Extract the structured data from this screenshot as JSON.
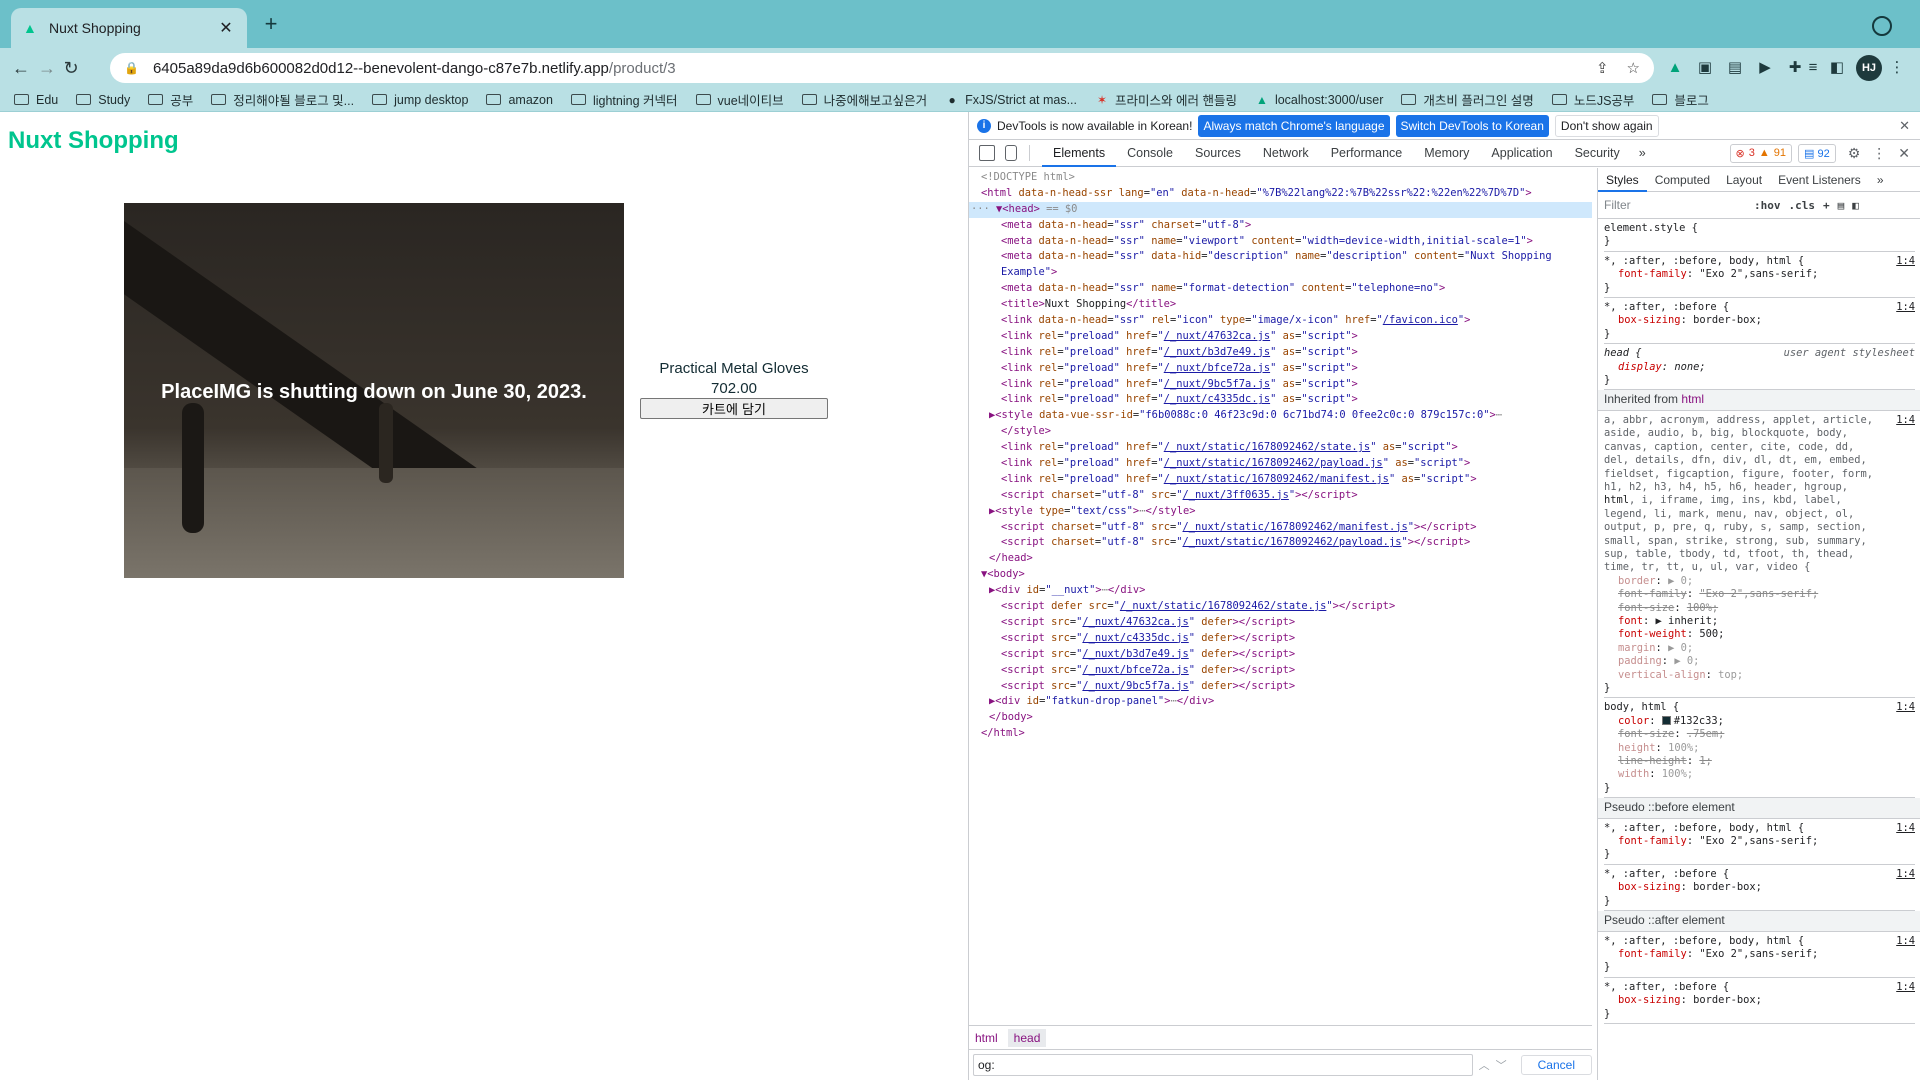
{
  "browser": {
    "tab_title": "Nuxt Shopping",
    "url_host": "6405a89da9d6b600082d0d12--benevolent-dango-c87e7b.netlify.app",
    "url_path": "/product/3",
    "avatar_initials": "HJ",
    "bookmarks": [
      "Edu",
      "Study",
      "공부",
      "정리해야될 블로그 및...",
      "jump desktop",
      "amazon",
      "lightning 커넥터",
      "vue네이티브",
      "나중에해보고싶은거",
      "FxJS/Strict at mas...",
      "프라미스와 에러 핸들링",
      "localhost:3000/user",
      "개츠비 플러그인 설명",
      "노드JS공부",
      "블로그"
    ]
  },
  "page": {
    "brand": "Nuxt Shopping",
    "image_caption": "PlaceIMG is shutting down on June 30, 2023.",
    "product_name": "Practical Metal Gloves",
    "product_price": "702.00",
    "cart_button": "카트에 담기"
  },
  "devtools": {
    "notice": "DevTools is now available in Korean!",
    "btn_match": "Always match Chrome's language",
    "btn_switch": "Switch DevTools to Korean",
    "btn_dont_show": "Don't show again",
    "tabs": [
      "Elements",
      "Console",
      "Sources",
      "Network",
      "Performance",
      "Memory",
      "Application",
      "Security"
    ],
    "errors": "3",
    "warnings": "91",
    "messages": "92",
    "style_tabs": [
      "Styles",
      "Computed",
      "Layout",
      "Event Listeners"
    ],
    "filter_placeholder": "Filter",
    "hov": ":hov",
    "cls": ".cls",
    "crumbs": [
      "html",
      "head"
    ],
    "search_value": "og:",
    "cancel": "Cancel",
    "inherited_label": "Inherited from",
    "inherited_tag": "html",
    "pseudo_before": "Pseudo ::before element",
    "pseudo_after": "Pseudo ::after element",
    "rule_src": "1:4",
    "ua_label": "user agent stylesheet"
  },
  "colors": {
    "brand": "#00c58e",
    "tabbar": "#6cc0c9",
    "toolbar": "#b9e0e4",
    "accent": "#1a73e8"
  }
}
